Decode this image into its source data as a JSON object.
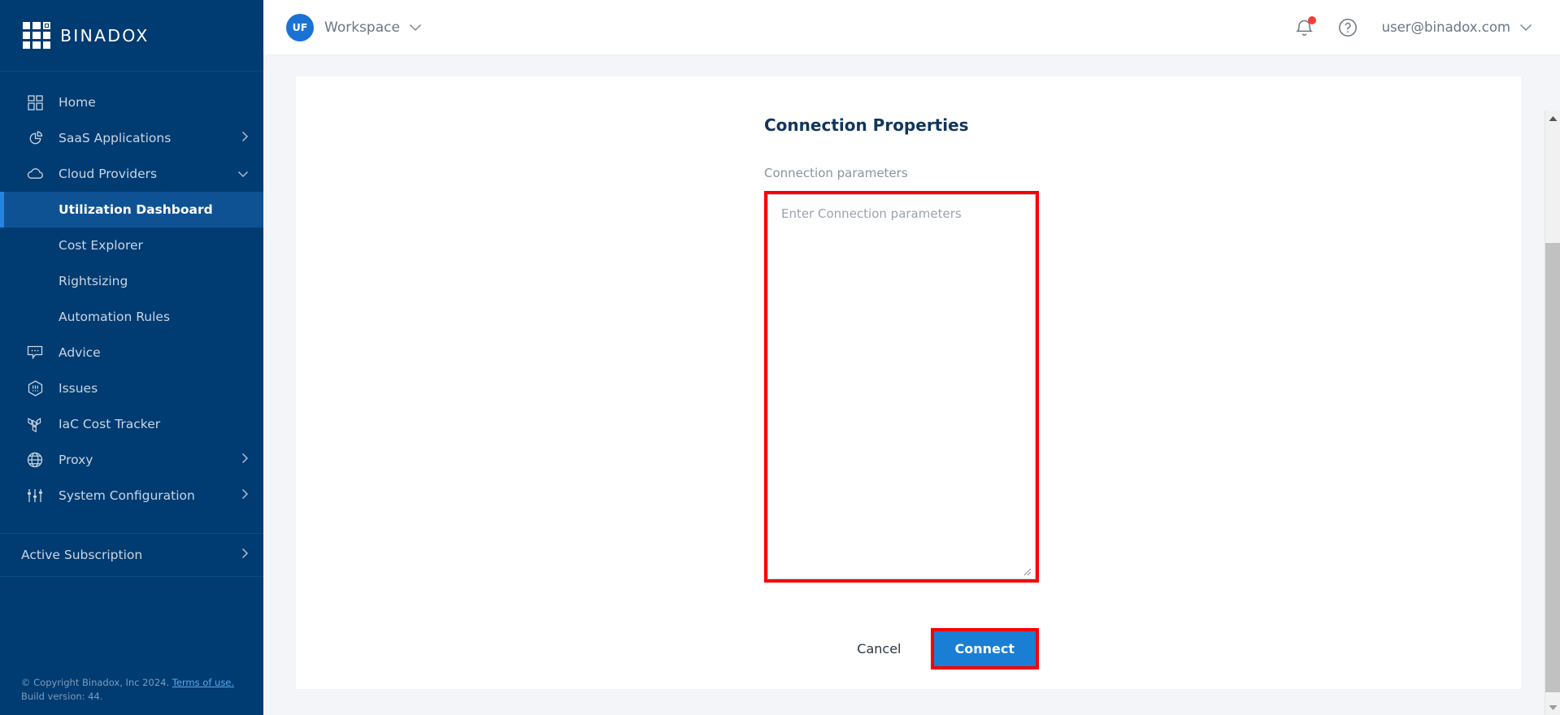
{
  "brand": {
    "name": "BINADOX",
    "logo_icon": "grid-logo-icon"
  },
  "sidebar": {
    "items": [
      {
        "label": "Home",
        "icon": "dashboard-grid-icon",
        "chevron": "",
        "active": false,
        "sub": false
      },
      {
        "label": "SaaS Applications",
        "icon": "pie-chart-icon",
        "chevron": "chevron-right-icon",
        "active": false,
        "sub": false
      },
      {
        "label": "Cloud Providers",
        "icon": "cloud-icon",
        "chevron": "chevron-down-icon",
        "active": false,
        "sub": false
      },
      {
        "label": "Utilization Dashboard",
        "icon": "",
        "chevron": "",
        "active": true,
        "sub": true
      },
      {
        "label": "Cost Explorer",
        "icon": "",
        "chevron": "",
        "active": false,
        "sub": true
      },
      {
        "label": "Rightsizing",
        "icon": "",
        "chevron": "",
        "active": false,
        "sub": true
      },
      {
        "label": "Automation Rules",
        "icon": "",
        "chevron": "",
        "active": false,
        "sub": true
      },
      {
        "label": "Advice",
        "icon": "speech-bubble-icon",
        "chevron": "",
        "active": false,
        "sub": false
      },
      {
        "label": "Issues",
        "icon": "hexagon-alert-icon",
        "chevron": "",
        "active": false,
        "sub": false
      },
      {
        "label": "IaC Cost Tracker",
        "icon": "terraform-icon",
        "chevron": "",
        "active": false,
        "sub": false
      },
      {
        "label": "Proxy",
        "icon": "globe-icon",
        "chevron": "chevron-right-icon",
        "active": false,
        "sub": false
      },
      {
        "label": "System Configuration",
        "icon": "sliders-icon",
        "chevron": "chevron-right-icon",
        "active": false,
        "sub": false
      }
    ],
    "subscription": {
      "label": "Active Subscription",
      "chevron": "chevron-right-icon"
    },
    "footer": {
      "copyright": "© Copyright Binadox, Inc 2024.",
      "terms_link": "Terms of use.",
      "build": "Build version: 44."
    }
  },
  "topbar": {
    "workspace": {
      "avatar_initials": "UF",
      "label": "Workspace",
      "chevron": "chevron-down-icon"
    },
    "notifications": {
      "icon": "bell-icon",
      "has_unread": true,
      "badge_color": "#f53b3b"
    },
    "help": {
      "icon": "question-circle-icon"
    },
    "user": {
      "email": "user@binadox.com",
      "chevron": "chevron-down-icon"
    }
  },
  "main": {
    "title": "Connection Properties",
    "field_label": "Connection parameters",
    "textarea": {
      "value": "",
      "placeholder": "Enter Connection parameters"
    },
    "cancel_label": "Cancel",
    "connect_label": "Connect",
    "highlight_color": "#fc0000",
    "primary_color": "#1a7fd4"
  },
  "scrollbar": {
    "up_icon": "triangle-up-icon",
    "down_icon": "triangle-down-icon"
  }
}
